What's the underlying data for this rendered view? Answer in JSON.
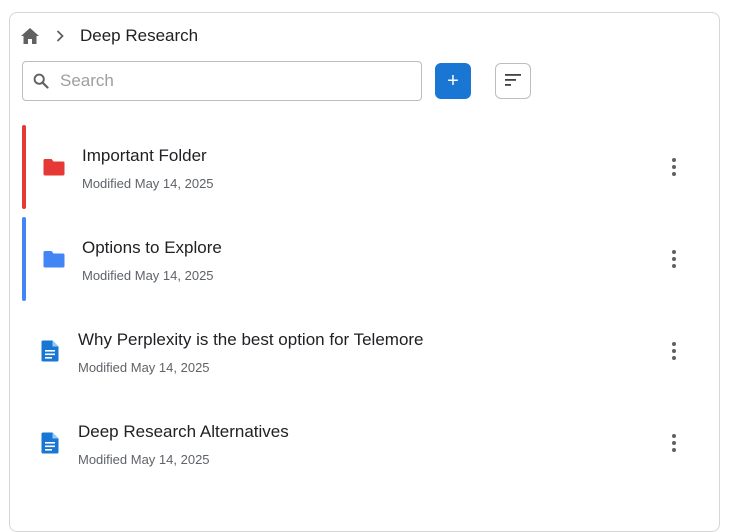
{
  "breadcrumb": {
    "home_icon": "home-icon",
    "separator_icon": "chevron-right-icon",
    "current": "Deep Research"
  },
  "search": {
    "placeholder": "Search",
    "value": ""
  },
  "toolbar": {
    "add_label": "+",
    "sort_icon": "sort-icon"
  },
  "items": [
    {
      "type": "folder",
      "title": "Important Folder",
      "modified": "Modified May 14, 2025",
      "accent_color": "#e53935",
      "icon_color": "#e53935"
    },
    {
      "type": "folder",
      "title": "Options to Explore",
      "modified": "Modified May 14, 2025",
      "accent_color": "#4285f4",
      "icon_color": "#4285f4"
    },
    {
      "type": "document",
      "title": "Why Perplexity is the best option for Telemore",
      "modified": "Modified May 14, 2025",
      "icon_color": "#1976d2"
    },
    {
      "type": "document",
      "title": "Deep Research Alternatives",
      "modified": "Modified May 14, 2025",
      "icon_color": "#1976d2"
    }
  ],
  "colors": {
    "primary": "#1976d2",
    "text": "#202124",
    "secondary_text": "#5f6368"
  }
}
